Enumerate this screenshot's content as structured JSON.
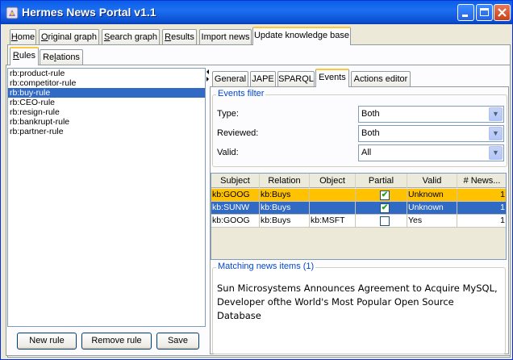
{
  "window": {
    "title": "Hermes News Portal v1.1"
  },
  "main_tabs": [
    {
      "label": "Home",
      "mnemonic": "H",
      "rest": "ome"
    },
    {
      "label": "Original graph",
      "mnemonic": "O",
      "rest": "riginal graph"
    },
    {
      "label": "Search graph",
      "mnemonic": "S",
      "rest": "earch graph"
    },
    {
      "label": "Results",
      "mnemonic": "R",
      "rest": "esults"
    },
    {
      "label": "Import news",
      "mnemonic": "",
      "rest": "Import news"
    },
    {
      "label": "Update knowledge base",
      "mnemonic": "",
      "rest": "Update knowledge base",
      "active": true
    }
  ],
  "sub_tabs": [
    {
      "label": "Rules",
      "mnemonic": "R",
      "rest": "ules",
      "active": true
    },
    {
      "label": "Relations",
      "pre": "Re",
      "mnemonic": "l",
      "rest": "ations"
    }
  ],
  "rules": [
    "rb:product-rule",
    "rb:competitor-rule",
    "rb:buy-rule",
    "rb:CEO-rule",
    "rb:resign-rule",
    "rb:bankrupt-rule",
    "rb:partner-rule"
  ],
  "selected_rule_index": 2,
  "buttons": {
    "new_rule": "New rule",
    "remove_rule": "Remove rule",
    "save": "Save"
  },
  "rule_tabs": [
    "General",
    "JAPE",
    "SPARQL",
    "Events",
    "Actions editor"
  ],
  "active_rule_tab": "Events",
  "events_filter": {
    "legend": "Events filter",
    "type_label": "Type:",
    "type_value": "Both",
    "reviewed_label": "Reviewed:",
    "reviewed_value": "Both",
    "valid_label": "Valid:",
    "valid_value": "All"
  },
  "events_table": {
    "columns": [
      "Subject",
      "Relation",
      "Object",
      "Partial",
      "Valid",
      "# News..."
    ],
    "rows": [
      {
        "subject": "kb:GOOG",
        "relation": "kb:Buys",
        "object": "",
        "partial": true,
        "valid": "Unknown",
        "news": "1",
        "style": "orange"
      },
      {
        "subject": "kb:SUNW",
        "relation": "kb:Buys",
        "object": "",
        "partial": true,
        "valid": "Unknown",
        "news": "1",
        "style": "blue"
      },
      {
        "subject": "kb:GOOG",
        "relation": "kb:Buys",
        "object": "kb:MSFT",
        "partial": false,
        "valid": "Yes",
        "news": "1",
        "style": "white"
      }
    ]
  },
  "matching_news": {
    "legend": "Matching news items (1)",
    "items": [
      "Sun Microsystems Announces Agreement to Acquire MySQL, Developer ofthe World's Most Popular Open Source Database"
    ]
  },
  "colors": {
    "title_bar": "#0b5ae6",
    "selection": "#316ac5",
    "highlight_row": "#ffc200",
    "group_label": "#0046d5"
  }
}
